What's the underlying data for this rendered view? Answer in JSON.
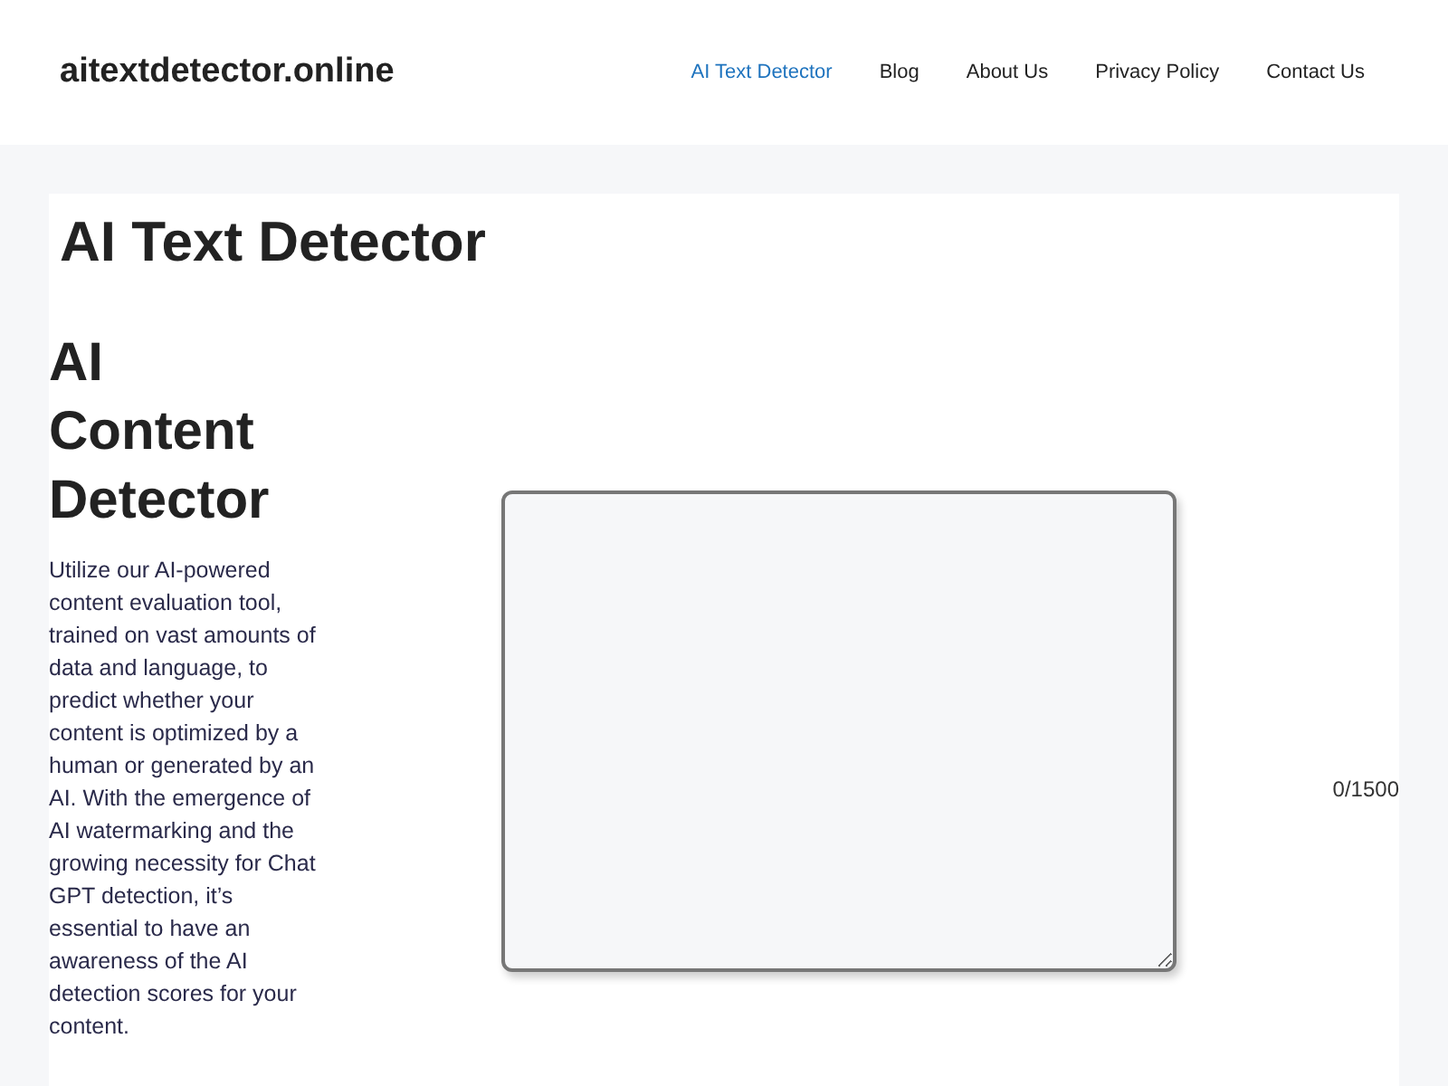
{
  "header": {
    "site_title": "aitextdetector.online",
    "nav": [
      {
        "label": "AI Text Detector",
        "selected": true
      },
      {
        "label": "Blog",
        "selected": false
      },
      {
        "label": "About Us",
        "selected": false
      },
      {
        "label": "Privacy Policy",
        "selected": false
      },
      {
        "label": "Contact Us",
        "selected": false
      }
    ]
  },
  "page_title": "AI Text Detector",
  "intro": {
    "heading": "AI Content Detector",
    "text": "Utilize our AI-powered content evaluation tool, trained on vast amounts of data and language, to predict whether your content is optimized by a human or generated by an AI. With the emergence of AI watermarking and the growing necessity for Chat GPT detection, it’s essential to have an awareness of the AI detection scores for your content."
  },
  "text_input": {
    "counter": "0/1500"
  }
}
